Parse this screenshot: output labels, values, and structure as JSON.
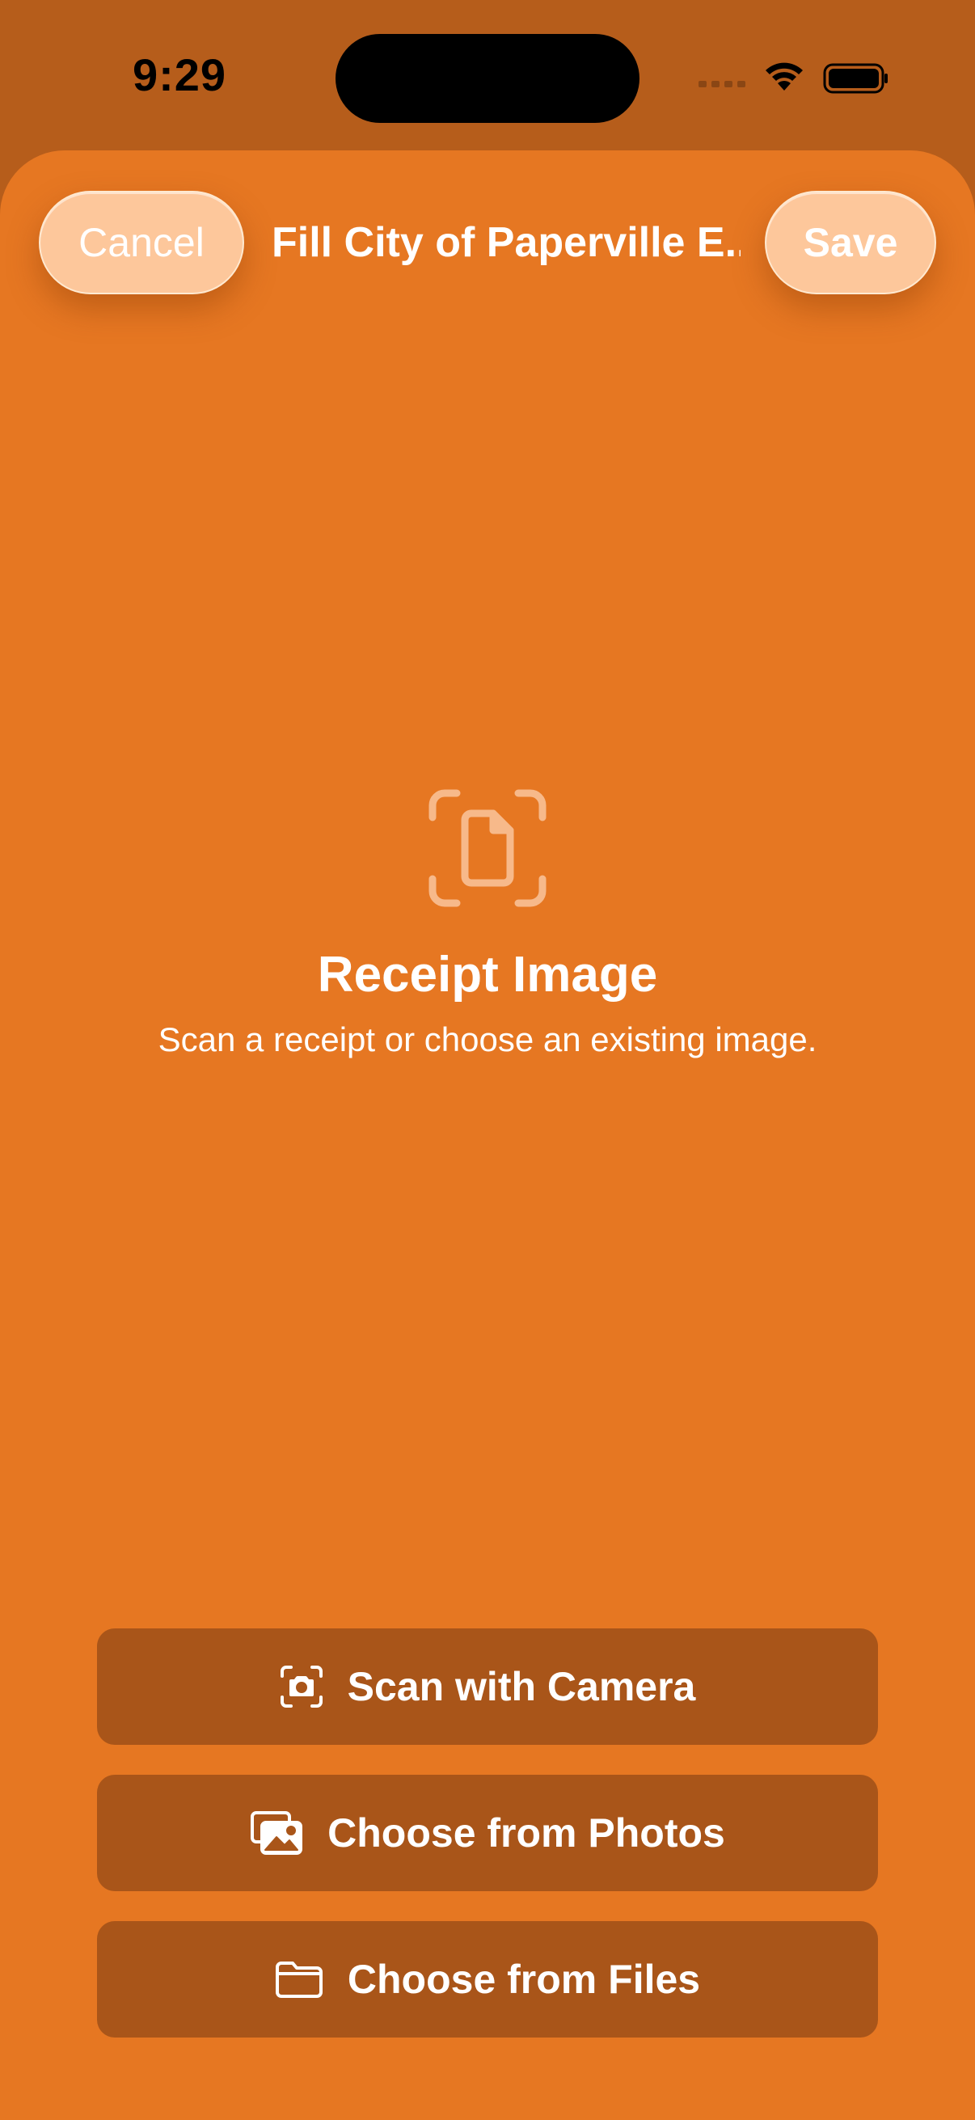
{
  "status_bar": {
    "time": "9:29"
  },
  "nav": {
    "cancel_label": "Cancel",
    "title": "Fill City of Paperville E...",
    "save_label": "Save"
  },
  "hero": {
    "icon": "doc-viewfinder-icon",
    "title": "Receipt Image",
    "subtitle": "Scan a receipt or choose an existing image."
  },
  "actions": [
    {
      "label": "Scan with Camera",
      "icon": "camera-viewfinder-icon"
    },
    {
      "label": "Choose from Photos",
      "icon": "photos-stack-icon"
    },
    {
      "label": "Choose from Files",
      "icon": "folder-icon"
    }
  ],
  "colors": {
    "status_bg": "#b65d1b",
    "sheet_bg": "#e67722",
    "pill_bg": "#fdc79b",
    "action_bg": "#a95519",
    "text": "#ffffff"
  }
}
